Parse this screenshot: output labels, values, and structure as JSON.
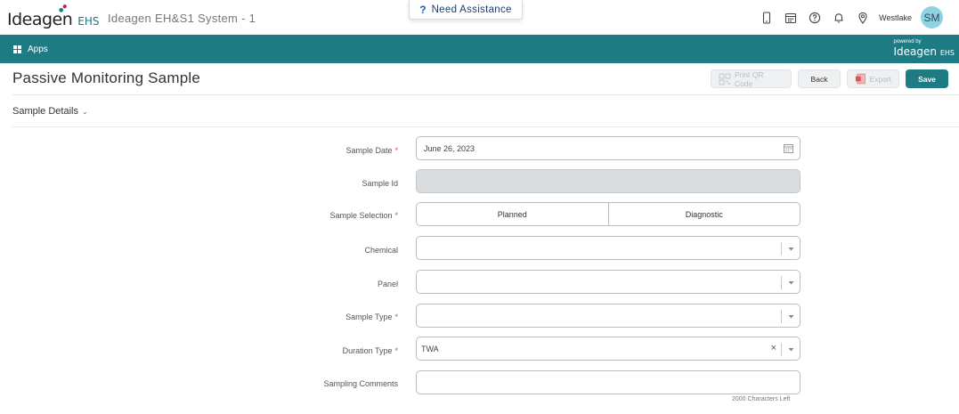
{
  "header": {
    "logo_text": "Ideagen",
    "logo_suffix": "EHS",
    "system_title": "Ideagen EH&S1 System - 1",
    "assistance_label": "Need Assistance",
    "assistance_icon": "question-icon",
    "location": "Westlake",
    "avatar_initials": "SM",
    "icons": [
      "mobile-icon",
      "calendar-icon",
      "help-circle-icon",
      "bell-icon",
      "location-pin-icon"
    ]
  },
  "nav": {
    "apps_label": "Apps",
    "powered_by": "powered by",
    "powered_logo": "Ideagen",
    "powered_logo_suffix": "EHS"
  },
  "page": {
    "title": "Passive Monitoring Sample",
    "section_title": "Sample Details"
  },
  "actions": {
    "print_qr_label": "Print QR Code",
    "back_label": "Back",
    "export_label": "Export",
    "save_label": "Save"
  },
  "form": {
    "sample_date": {
      "label": "Sample Date",
      "required": true,
      "value": "June 26, 2023"
    },
    "sample_id": {
      "label": "Sample Id",
      "required": false,
      "value": ""
    },
    "sample_selection": {
      "label": "Sample Selection",
      "required": true,
      "options": [
        "Planned",
        "Diagnostic"
      ]
    },
    "chemical": {
      "label": "Chemical",
      "required": false,
      "value": ""
    },
    "panel": {
      "label": "Panel",
      "required": false,
      "value": ""
    },
    "sample_type": {
      "label": "Sample Type",
      "required": true,
      "value": ""
    },
    "duration_type": {
      "label": "Duration Type",
      "required": true,
      "value": "TWA",
      "clear": "×"
    },
    "sampling_comments": {
      "label": "Sampling Comments",
      "required": false,
      "value": "",
      "counter": "2000 Characters Left"
    },
    "required_marker": "*"
  },
  "colors": {
    "brand_teal": "#1e7a83",
    "required_red": "#d9534f",
    "avatar_bg": "#8fd3e3"
  }
}
